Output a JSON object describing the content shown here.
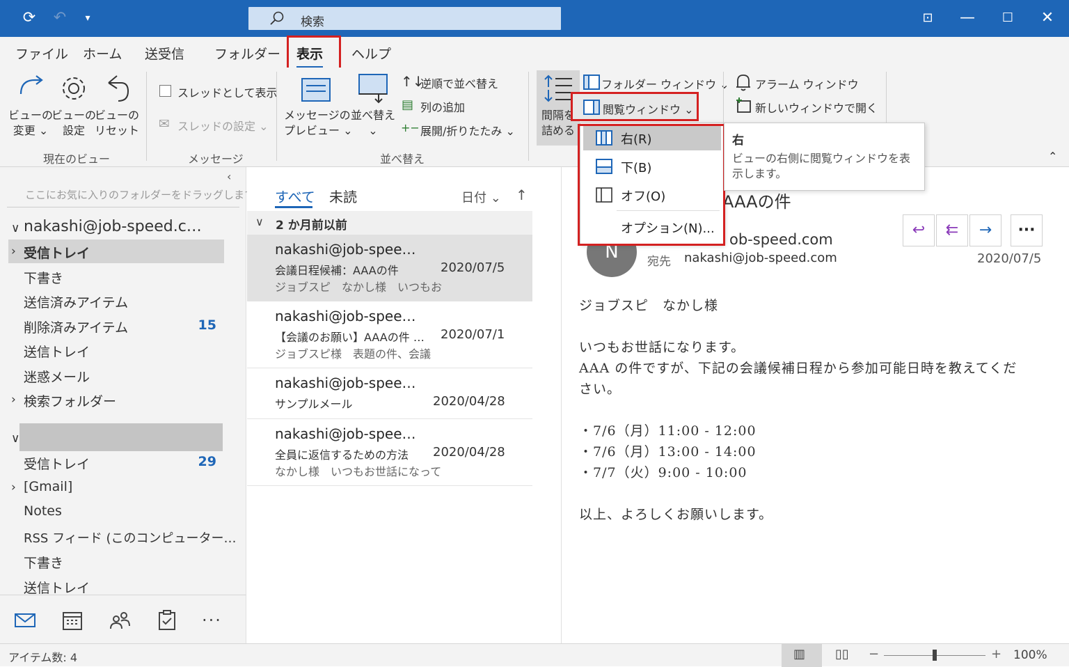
{
  "titlebar": {
    "search_placeholder": "検索"
  },
  "ribbon_tabs": [
    "ファイル",
    "ホーム",
    "送受信",
    "フォルダー",
    "表示",
    "ヘルプ"
  ],
  "ribbon": {
    "view_change": "ビューの\n変更 ⌄",
    "view_settings": "ビューの\n設定",
    "view_reset": "ビューの\nリセット",
    "group_current_view": "現在のビュー",
    "show_as_threads": "スレッドとして表示",
    "thread_settings": "スレッドの設定 ⌄",
    "group_messages": "メッセージ",
    "message_preview": "メッセージの\nプレビュー ⌄",
    "sort": "並べ替え\n⌄",
    "reverse_sort": "逆順で並べ替え",
    "add_column": "列の追加",
    "expand_collapse": "展開/折りたたみ ⌄",
    "group_arrange": "並べ替え",
    "spacing": "間隔を\n詰める",
    "folder_window": "フォルダー ウィンドウ ⌄",
    "reading_pane": "閲覧ウィンドウ ⌄",
    "alarm_window": "アラーム ウィンドウ",
    "open_new_window": "新しいウィンドウで開く"
  },
  "dropdown": {
    "items": [
      "右(R)",
      "下(B)",
      "オフ(O)",
      "オプション(N)..."
    ],
    "tooltip_title": "右",
    "tooltip_text": "ビューの右側に閲覧ウィンドウを表示します。"
  },
  "folder_pane": {
    "favorites_hint": "ここにお気に入りのフォルダーをドラッグします",
    "account1": "nakashi@job-speed.c…",
    "account1_folders": [
      {
        "label": "受信トレイ",
        "count": ""
      },
      {
        "label": "下書き",
        "count": ""
      },
      {
        "label": "送信済みアイテム",
        "count": ""
      },
      {
        "label": "削除済みアイテム",
        "count": "15"
      },
      {
        "label": "送信トレイ",
        "count": ""
      },
      {
        "label": "迷惑メール",
        "count": ""
      },
      {
        "label": "検索フォルダー",
        "count": ""
      }
    ],
    "account2_folders": [
      {
        "label": "受信トレイ",
        "count": "29"
      },
      {
        "label": "[Gmail]",
        "count": ""
      },
      {
        "label": "Notes",
        "count": ""
      },
      {
        "label": "RSS フィード (このコンピューター…",
        "count": ""
      },
      {
        "label": "下書き",
        "count": ""
      },
      {
        "label": "送信トレイ",
        "count": ""
      }
    ]
  },
  "msglist": {
    "tab_all": "すべて",
    "tab_unread": "未読",
    "sort_by": "日付 ⌄",
    "sort_dir": "↑",
    "group_header": "2 か月前以前",
    "messages": [
      {
        "from": "nakashi@job-spee…",
        "subject": "会議日程候補：AAAの件",
        "date": "2020/07/5",
        "preview": "ジョブスピ　なかし様　いつもお"
      },
      {
        "from": "nakashi@job-spee…",
        "subject": "【会議のお願い】AAAの件 …",
        "date": "2020/07/1",
        "preview": "ジョブスピ様　表題の件、会議"
      },
      {
        "from": "nakashi@job-spee…",
        "subject": "サンプルメール",
        "date": "2020/04/28",
        "preview": ""
      },
      {
        "from": "nakashi@job-spee…",
        "subject": "全員に返信するための方法",
        "date": "2020/04/28",
        "preview": "なかし様　いつもお世話になって"
      }
    ]
  },
  "reading": {
    "subject": "AAAの件",
    "avatar_letter": "N",
    "sender": "ob-speed.com",
    "to_label": "宛先",
    "to": "nakashi@job-speed.com",
    "date": "2020/07/5",
    "body": [
      "ジョブスピ　なかし様",
      "いつもお世話になります。",
      "AAA の件ですが、下記の会議候補日程から参加可能日時を教えてくだ",
      "さい。",
      "・7/6（月）11:00 - 12:00",
      "・7/6（月）13:00 - 14:00",
      "・7/7（火）9:00 - 10:00",
      "以上、よろしくお願いします。"
    ]
  },
  "statusbar": {
    "item_count": "アイテム数: 4",
    "zoom": "100%"
  },
  "colors": {
    "accent": "#1e66b7",
    "highlight": "#d42121"
  }
}
